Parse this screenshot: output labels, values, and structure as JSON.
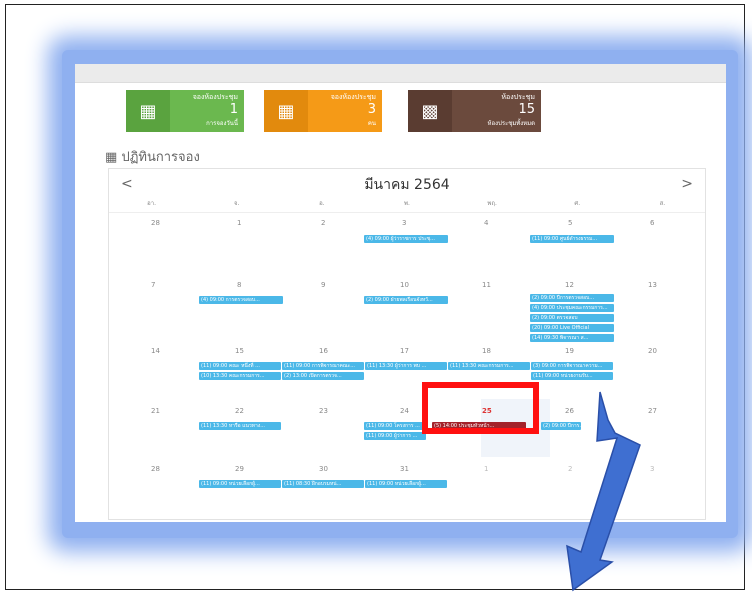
{
  "cards": [
    {
      "title": "จองห้องประชุม",
      "number": "1",
      "subtitle": "การจองวันนี้",
      "icon": "calendar-icon",
      "color": "#6bb84f"
    },
    {
      "title": "จองห้องประชุม",
      "number": "3",
      "subtitle": "คน",
      "icon": "calendar-icon",
      "color": "#f59a17"
    },
    {
      "title": "ห้องประชุม",
      "number": "15",
      "subtitle": "ห้องประชุมทั้งหมด",
      "icon": "building-icon",
      "color": "#6b4a3d"
    }
  ],
  "section_title": "ปฏิทินการจอง",
  "calendar": {
    "prev": "<",
    "next": ">",
    "month_label": "มีนาคม 2564",
    "weekdays": [
      "อา.",
      "จ.",
      "อ.",
      "พ.",
      "พฤ.",
      "ศ.",
      "ส."
    ],
    "days": [
      [
        "28",
        "1",
        "2",
        "3",
        "4",
        "5",
        "6"
      ],
      [
        "7",
        "8",
        "9",
        "10",
        "11",
        "12",
        "13"
      ],
      [
        "14",
        "15",
        "16",
        "17",
        "18",
        "19",
        "20"
      ],
      [
        "21",
        "22",
        "23",
        "24",
        "25",
        "26",
        "27"
      ],
      [
        "28",
        "29",
        "30",
        "31",
        "1",
        "2",
        "3"
      ]
    ],
    "events": {
      "ev_3_1": "(4) 09:00 ผู้ว่าราชการ ประชุ...",
      "ev_5_1": "(11) 09:00 ศูนย์ดำรงธรรม...",
      "ev_8_1": "(4) 09:00 การตรวจสอบ...",
      "ev_10_1": "(2) 09:00 ฝ่ายพลเรือนจังหวั...",
      "ev_12_1": "(2) 09:00 ปีการตรวจสอบ...",
      "ev_12_2": "(4) 09:00 ประชุมคณะกรรมการ...",
      "ev_12_3": "(2) 09:00 ตรวจสอบ",
      "ev_12_4": "(20) 09:00 Live Official",
      "ev_12_5": "(14) 09:30 พิจารณา ส...",
      "ev_15_1": "(11) 09:00 คณะ หนึ่งที่ ...",
      "ev_15_2": "(10) 13:30 คณะกรรมการ...",
      "ev_16_1": "(11) 09:00 การพิจารณาคณะ...",
      "ev_16_2": "(2) 13:00 เปิดการตรวจ...",
      "ev_17_1": "(11) 13:30 ผู้ว่าการ พบ ...",
      "ev_18_1": "(11) 13:30 คณะกรรมการ...",
      "ev_19_1": "(3) 09:00 การพิจารณาความ...",
      "ev_19_2": "(11) 09:00 หน่วยงานรับ...",
      "ev_22_1": "(11) 13:30 หารือ แนวทาง...",
      "ev_24_1": "(11) 09:00 โครงการ ...",
      "ev_24_2": "(11) 09:00 ผู้ว่าการ ...",
      "ev_25_1": "(5) 14:00 ประชุมหัวหน้า...",
      "ev_26_1": "(2) 09:00 ปีการ...",
      "ev_29_1": "(11) 09:00 หน่วยเลือกผู้...",
      "ev_30_1": "(11) 08:30 ฝึกอบรมหน่...",
      "ev_31_1": "(11) 09:00 หน่วยเลือกผู้..."
    }
  },
  "colors": {
    "event": "#4bb8e8",
    "event_selected": "#a3222a",
    "highlight_box": "#ff1010",
    "arrow": "#3f6fd1",
    "glow": "#8fb0f0"
  }
}
